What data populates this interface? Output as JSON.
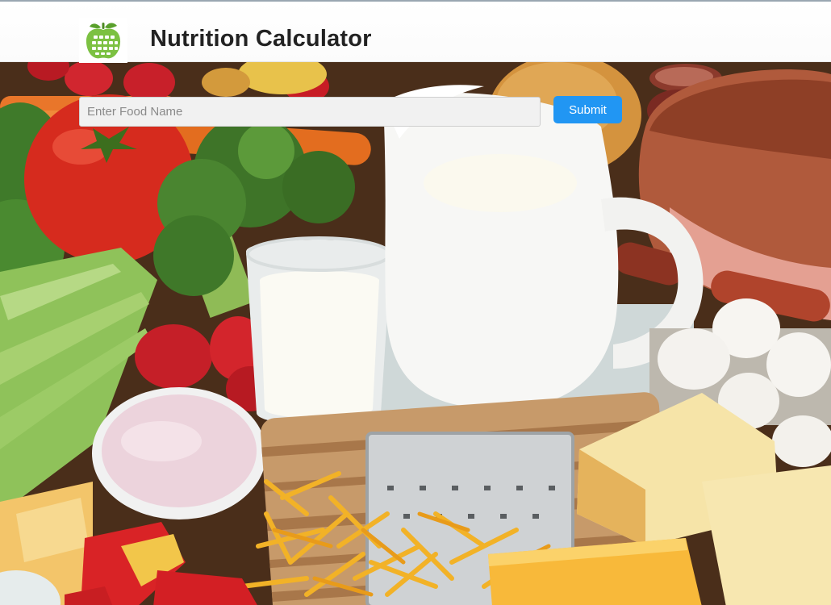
{
  "header": {
    "title": "Nutrition Calculator",
    "logo_icon": "apple-calculator-icon"
  },
  "search": {
    "placeholder": "Enter Food Name",
    "value": "",
    "submit_label": "Submit"
  },
  "hero": {
    "image_icon": "food-background-image"
  },
  "colors": {
    "accent": "#2196f3",
    "logo_green": "#7cc142",
    "title_text": "#222222"
  }
}
